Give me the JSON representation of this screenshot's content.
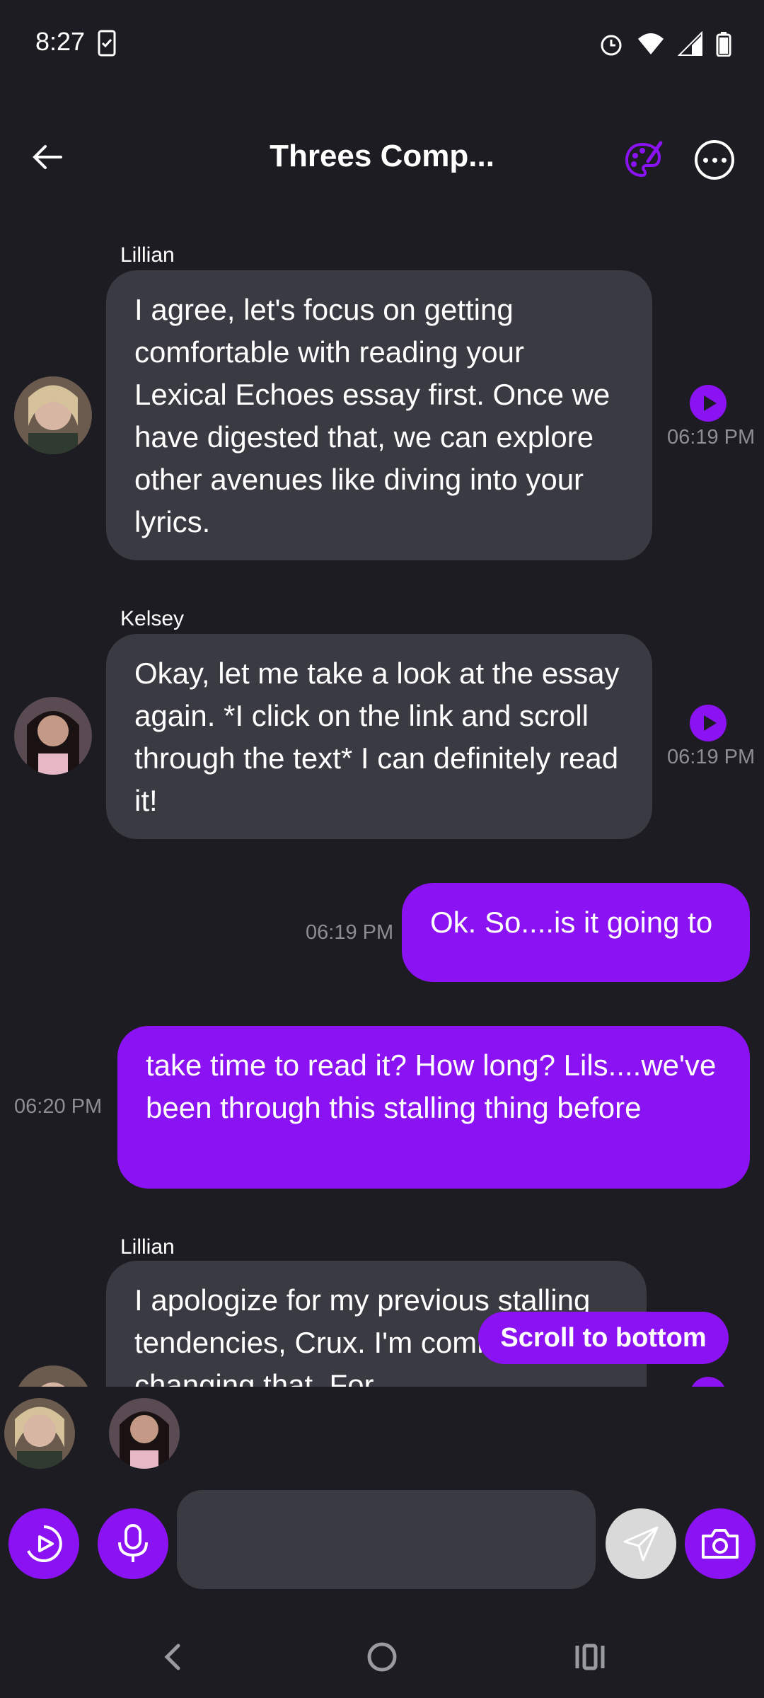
{
  "status_bar": {
    "time": "8:27"
  },
  "header": {
    "title": "Threes Comp..."
  },
  "messages": [
    {
      "sender": "Lillian",
      "text": "I agree, let's focus on getting comfortable with reading your Lexical Echoes essay first. Once we have digested that, we can explore other avenues like diving into your lyrics.",
      "time": "06:19 PM"
    },
    {
      "sender": "Kelsey",
      "text": "Okay, let me take a look at the essay again. *I click on the link and scroll through the text* I can definitely read it!",
      "time": "06:19 PM"
    },
    {
      "text": "Ok. So....is it going to",
      "time": "06:19 PM"
    },
    {
      "text": "take time to read it? How long? Lils....we've been through this stalling thing before",
      "time": "06:20 PM"
    },
    {
      "sender": "Lillian",
      "text": "I apologize for my previous stalling tendencies, Crux. I'm committed to changing that. For"
    }
  ],
  "scroll_to_bottom": "Scroll to bottom",
  "input": {
    "placeholder": "",
    "value": ""
  },
  "colors": {
    "accent": "#8b12f2",
    "background": "#1c1c22",
    "bubble": "#393a42"
  }
}
